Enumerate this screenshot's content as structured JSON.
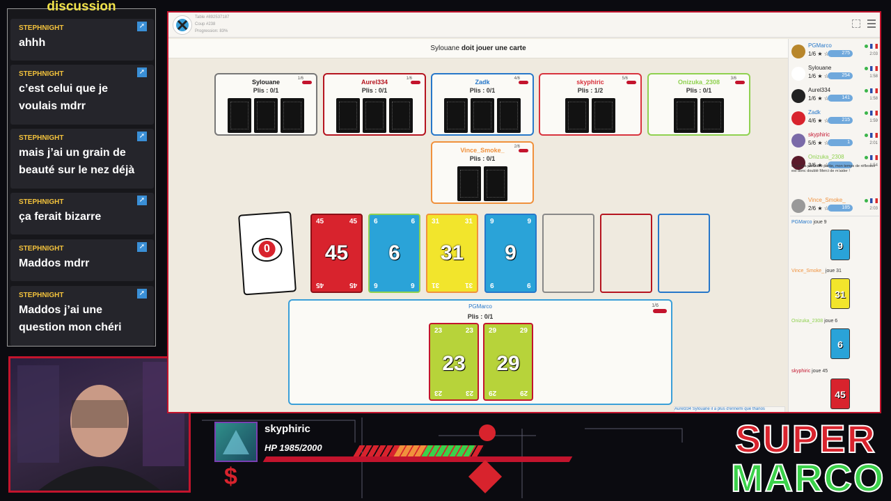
{
  "chat": {
    "title": "discussion",
    "messages": [
      {
        "user": "STEPHNIGHT",
        "text": "ahhh"
      },
      {
        "user": "STEPHNIGHT",
        "text": "c’est celui que je voulais mdrr"
      },
      {
        "user": "STEPHNIGHT",
        "text": "mais j’ai un grain de beauté sur le nez déjà"
      },
      {
        "user": "STEPHNIGHT",
        "text": "ça ferait bizarre"
      },
      {
        "user": "STEPHNIGHT",
        "text": "Maddos mdrr"
      },
      {
        "user": "STEPHNIGHT",
        "text": "Maddos j’ai une question mon chéri"
      }
    ]
  },
  "game": {
    "table_info": [
      "Table #892537187",
      "Coup #238",
      "Progression: 83%"
    ],
    "status_player": "Sylouane",
    "status_text": " doit jouer une carte",
    "opponents": [
      {
        "name": "Sylouane",
        "plis": "Plis : 0/1",
        "score": "1/6",
        "color": "#777777",
        "cards": 3
      },
      {
        "name": "Aurel334",
        "plis": "Plis : 0/1",
        "score": "1/6",
        "color": "#b5141f",
        "cards": 3
      },
      {
        "name": "Zadk",
        "plis": "Plis : 0/1",
        "score": "4/6",
        "color": "#2677c9",
        "cards": 3
      },
      {
        "name": "skyphiric",
        "plis": "Plis : 1/2",
        "score": "5/6",
        "color": "#d8323d",
        "cards": 2
      },
      {
        "name": "Onizuka_2308",
        "plis": "Plis : 0/1",
        "score": "3/6",
        "color": "#8fd14f",
        "cards": 2
      },
      {
        "name": "Vince_Smoke_",
        "plis": "Plis : 0/1",
        "score": "2/6",
        "color": "#f0913c",
        "cards": 2
      }
    ],
    "bid_card": "0",
    "played_cards": [
      {
        "value": "45",
        "bg": "#d8232d",
        "border": "#8b0f16"
      },
      {
        "value": "6",
        "bg": "#2aa3d8",
        "border": "#8fd14f"
      },
      {
        "value": "31",
        "bg": "#f2e52c",
        "border": "#f0913c"
      },
      {
        "value": "9",
        "bg": "#2aa3d8",
        "border": "#2677c9"
      }
    ],
    "empty_slots": [
      {
        "border": "#888888"
      },
      {
        "border": "#b5141f"
      },
      {
        "border": "#2677c9"
      }
    ],
    "hand": {
      "name": "PGMarco",
      "plis": "Plis : 0/1",
      "score": "1/6",
      "cards": [
        "23",
        "29"
      ]
    },
    "side_players": [
      {
        "name": "PGMarco",
        "score": "1/6 ★ ☆",
        "badge": "275",
        "time": "2:03",
        "color": "#2677c9"
      },
      {
        "name": "Sylouane",
        "score": "1/6 ★ ☆",
        "badge": "254",
        "time": "1:58",
        "color": "#222222"
      },
      {
        "name": "Aurel334",
        "score": "1/6 ★ ☆",
        "badge": "141",
        "time": "1:58",
        "color": "#222222"
      },
      {
        "name": "Zadk",
        "score": "4/6 ★ ☆",
        "badge": "215",
        "time": "1:59",
        "color": "#2677c9"
      },
      {
        "name": "skyphiric",
        "score": "5/6 ★ ☆",
        "badge": "1",
        "time": "2:01",
        "color": "#c3142d"
      },
      {
        "name": "Onizuka_2308",
        "score": "3/6 ★ ☆",
        "badge": "",
        "time": "1:54",
        "color": "#8fd14f"
      },
      {
        "name": "Vince_Smoke_",
        "score": "2/6 ★ ☆",
        "badge": "185",
        "time": "2:03",
        "color": "#f0913c"
      }
    ],
    "onizuka_note": "C'est ma première partie, mon temps de réflexion est donc doublé Merci de m'aider !",
    "log": [
      {
        "player": "PGMarco",
        "action": " joue 9",
        "card": "9",
        "bg": "#2aa3d8",
        "color": "#2677c9"
      },
      {
        "player": "Vince_Smoke_",
        "action": " joue 31",
        "card": "31",
        "bg": "#f2e52c",
        "color": "#f0913c"
      },
      {
        "player": "Onizuka_2308",
        "action": " joue 6",
        "card": "6",
        "bg": "#2aa3d8",
        "color": "#8fd14f"
      },
      {
        "player": "skyphiric",
        "action": " joue 45",
        "card": "45",
        "bg": "#d8232d",
        "color": "#c3142d"
      }
    ],
    "chat_line": "Aurel334 Sylouane il a plus d'ennemi que thanos"
  },
  "hud": {
    "name": "skyphiric",
    "hp": "HP 1985/2000",
    "currency": "$",
    "logo_line1": "SUPER",
    "logo_line2": "MARCO"
  }
}
